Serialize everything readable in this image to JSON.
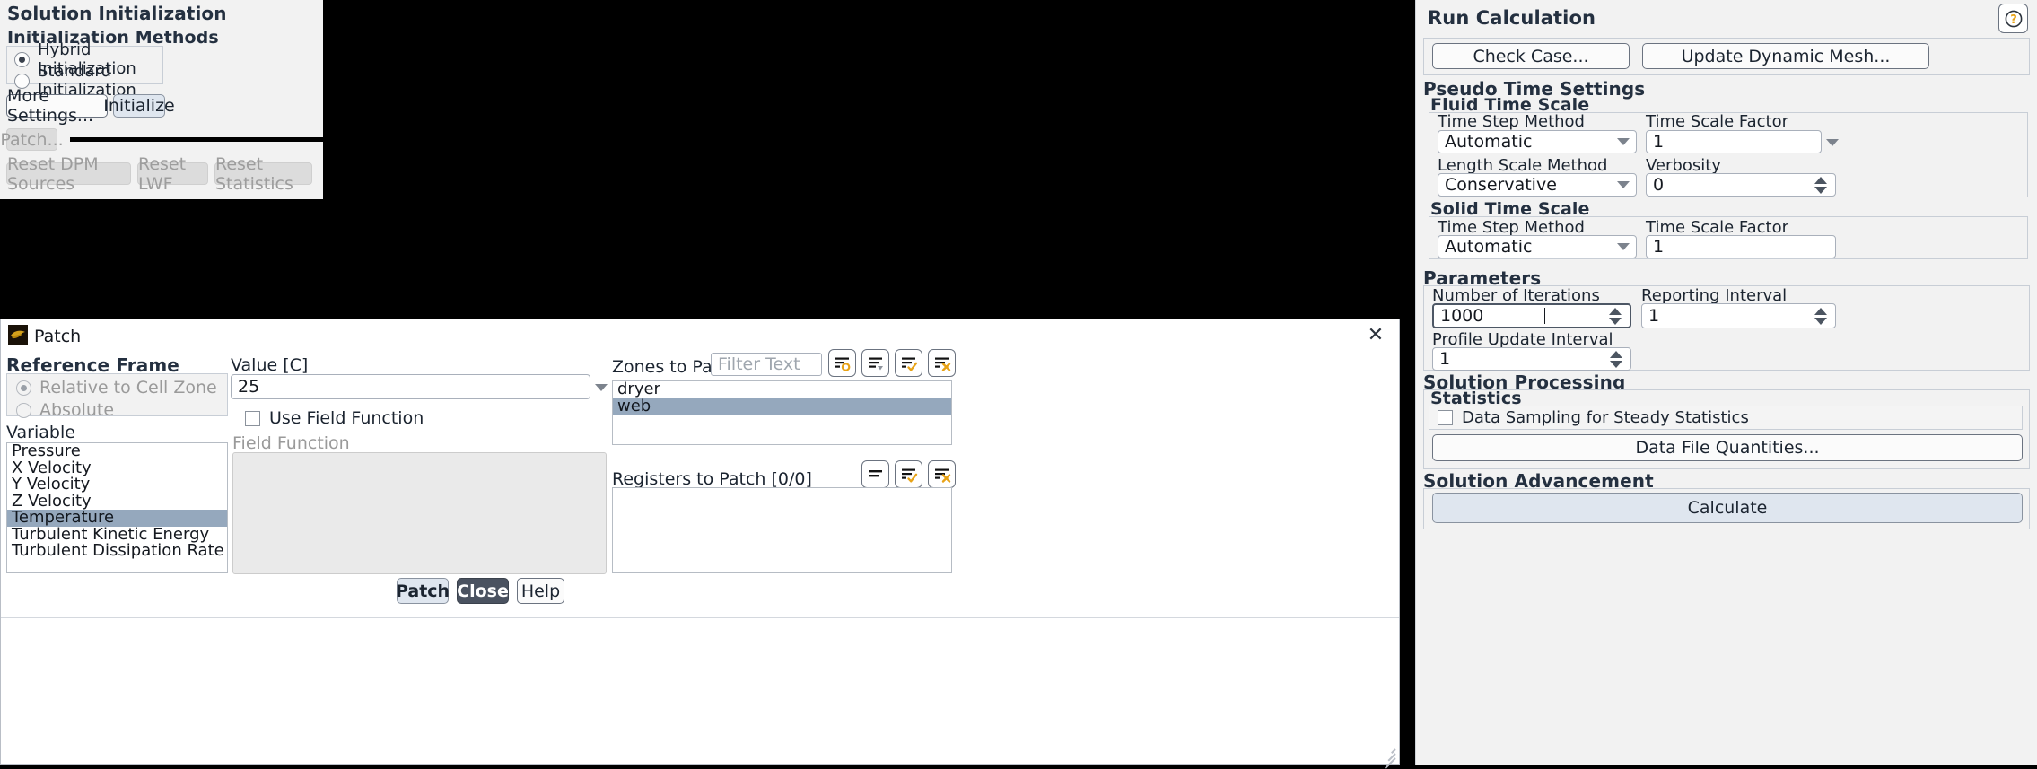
{
  "solution_initialization": {
    "title": "Solution Initialization",
    "methods_title": "Initialization Methods",
    "methods": [
      {
        "label": "Hybrid  Initialization",
        "selected": true
      },
      {
        "label": "Standard Initialization",
        "selected": false
      }
    ],
    "more_settings_label": "More Settings...",
    "initialize_label": "Initialize",
    "patch_label": "Patch...",
    "reset_dpm_label": "Reset DPM Sources",
    "reset_lwf_label": "Reset LWF",
    "reset_stats_label": "Reset Statistics"
  },
  "patch_dialog": {
    "title": "Patch",
    "close_glyph": "✕",
    "reference_frame": {
      "title": "Reference Frame",
      "options": [
        {
          "label": "Relative to Cell Zone",
          "selected": true
        },
        {
          "label": "Absolute",
          "selected": false
        }
      ]
    },
    "variable": {
      "title": "Variable",
      "items": [
        "Pressure",
        "X Velocity",
        "Y Velocity",
        "Z Velocity",
        "Temperature",
        "Turbulent Kinetic Energy",
        "Turbulent Dissipation Rate"
      ],
      "selected": "Temperature"
    },
    "value": {
      "label": "Value [C]",
      "value": "25"
    },
    "use_field_function": {
      "label": "Use Field Function",
      "checked": false
    },
    "field_function": {
      "label": "Field Function",
      "value": "",
      "disabled": true
    },
    "zones_to_patch": {
      "label": "Zones to Patch",
      "filter_placeholder": "Filter Text",
      "items": [
        "dryer",
        "web"
      ],
      "selected": "web",
      "tool_icons": [
        "list-filter-icon",
        "list-dropdown-icon",
        "select-all-icon",
        "deselect-all-icon"
      ]
    },
    "registers_to_patch": {
      "label": "Registers to Patch  [0/0]",
      "items": [],
      "tool_icons": [
        "list-icon",
        "select-all-icon",
        "deselect-all-icon"
      ]
    },
    "buttons": {
      "patch": "Patch",
      "close": "Close",
      "help": "Help"
    }
  },
  "run_calculation": {
    "title": "Run Calculation",
    "help_glyph": "?",
    "check_case_label": "Check Case...",
    "update_dynamic_mesh_label": "Update Dynamic Mesh...",
    "pseudo_time_settings": {
      "title": "Pseudo Time Settings",
      "fluid_time_scale": {
        "title": "Fluid Time Scale",
        "time_step_method_label": "Time Step Method",
        "time_step_method_value": "Automatic",
        "time_scale_factor_label": "Time Scale Factor",
        "time_scale_factor_value": "1",
        "length_scale_method_label": "Length Scale Method",
        "length_scale_method_value": "Conservative",
        "verbosity_label": "Verbosity",
        "verbosity_value": "0"
      },
      "solid_time_scale": {
        "title": "Solid Time Scale",
        "time_step_method_label": "Time Step Method",
        "time_step_method_value": "Automatic",
        "time_scale_factor_label": "Time Scale Factor",
        "time_scale_factor_value": "1"
      }
    },
    "parameters": {
      "title": "Parameters",
      "number_of_iterations_label": "Number of Iterations",
      "number_of_iterations_value": "1000",
      "reporting_interval_label": "Reporting Interval",
      "reporting_interval_value": "1",
      "profile_update_interval_label": "Profile Update Interval",
      "profile_update_interval_value": "1"
    },
    "solution_processing": {
      "title": "Solution Processing",
      "statistics_title": "Statistics",
      "data_sampling_label": "Data Sampling for Steady Statistics",
      "data_sampling_checked": false,
      "data_file_quantities_label": "Data File Quantities..."
    },
    "solution_advancement": {
      "title": "Solution Advancement",
      "calculate_label": "Calculate"
    }
  },
  "colors": {
    "panel": "#f2f2f2",
    "accent_gold": "#e8a317",
    "selection": "#95a8bd",
    "dark_button": "#4a5260",
    "blue_button": "#dfe6ef"
  }
}
